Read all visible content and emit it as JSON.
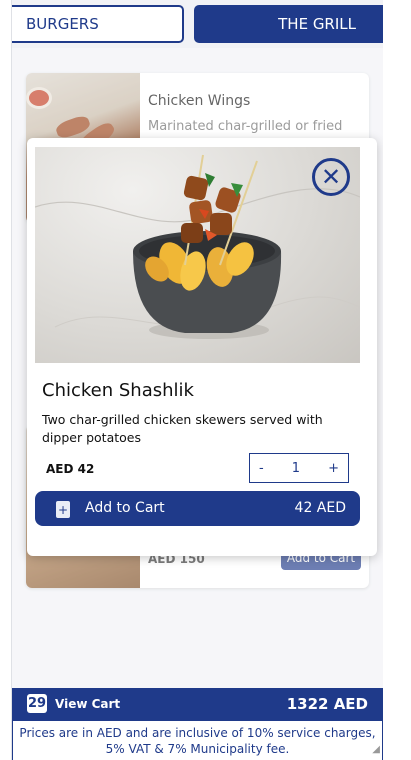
{
  "tabs": [
    {
      "label": "BURGERS"
    },
    {
      "label": "THE GRILL"
    }
  ],
  "cards": [
    {
      "title": "Chicken Wings",
      "description": "Marinated char-grilled or fried"
    },
    {
      "price": "AED 150",
      "button": "Add to Cart"
    }
  ],
  "modal": {
    "title": "Chicken Shashlik",
    "description": "Two char-grilled chicken skewers served with dipper potatoes",
    "price": "AED 42",
    "quantity": {
      "minus": "-",
      "value": "1",
      "plus": "+"
    },
    "add_button": {
      "plus": "+",
      "label": "Add to Cart",
      "total": "42 AED"
    },
    "close_icon": "close-icon"
  },
  "cart": {
    "count": "29",
    "label": "View Cart",
    "total": "1322 AED"
  },
  "disclaimer": "Prices are in AED and are inclusive of 10% service charges, 5% VAT & 7% Municipality fee.",
  "stray_mark": ",",
  "colors": {
    "primary": "#1f3a8a",
    "background": "#f1f2f6"
  }
}
